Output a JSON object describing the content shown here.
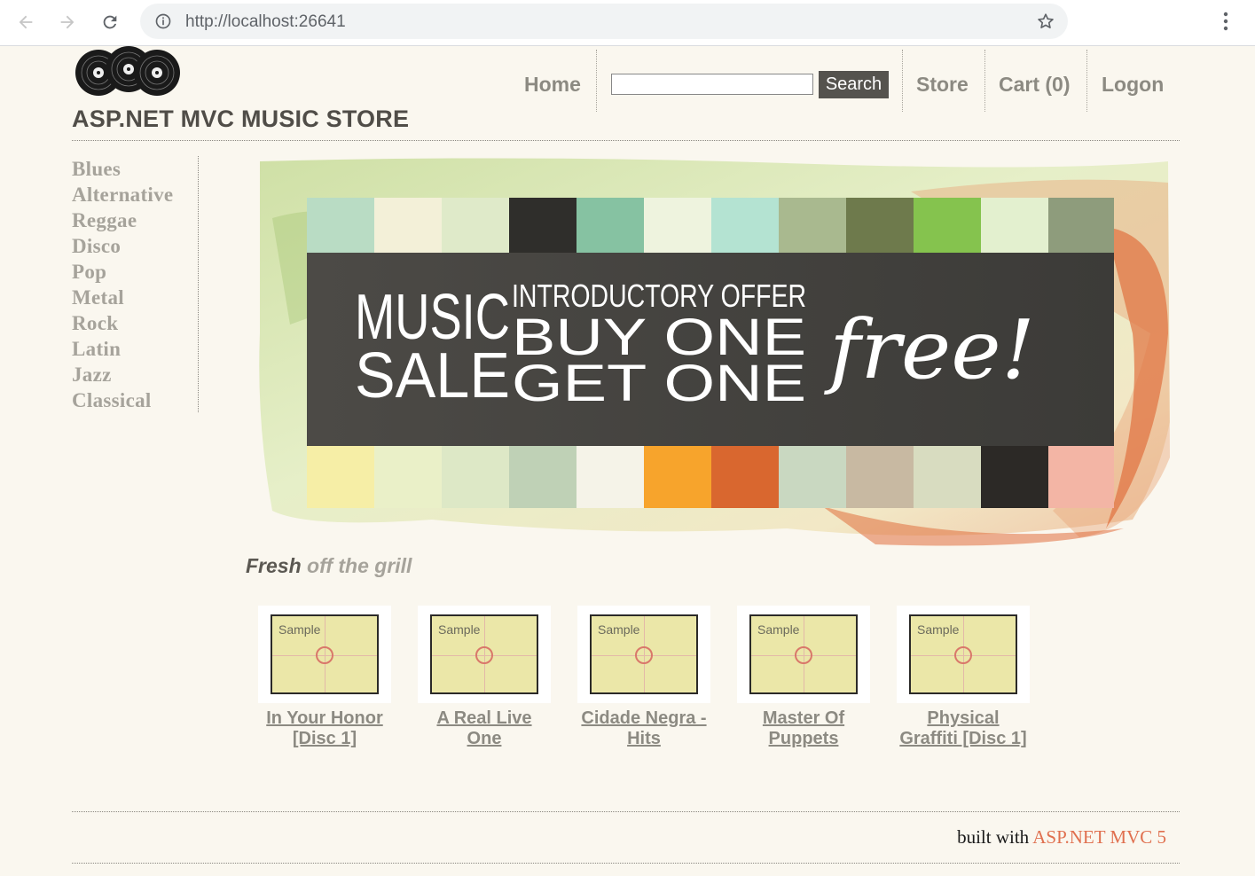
{
  "browser": {
    "url_host": "http://localhost",
    "url_port": ":26641"
  },
  "site": {
    "title": "ASP.NET MVC MUSIC STORE"
  },
  "nav": {
    "home": "Home",
    "search_button": "Search",
    "search_value": "",
    "store": "Store",
    "cart": "Cart (0)",
    "logon": "Logon"
  },
  "genres": [
    "Blues",
    "Alternative",
    "Reggae",
    "Disco",
    "Pop",
    "Metal",
    "Rock",
    "Latin",
    "Jazz",
    "Classical"
  ],
  "banner": {
    "line_music": "MUSIC",
    "line_sale": "SALE",
    "line_intro": "INTRODUCTORY OFFER",
    "line_buy": "BUY ONE",
    "line_get": "GET ONE",
    "line_free": "free!"
  },
  "fresh": {
    "strong": "Fresh",
    "rest": " off the grill"
  },
  "albums": [
    {
      "title": "In Your Honor [Disc 1]",
      "thumb_label": "Sample"
    },
    {
      "title": "A Real Live One",
      "thumb_label": "Sample"
    },
    {
      "title": "Cidade Negra - Hits",
      "thumb_label": "Sample"
    },
    {
      "title": "Master Of Puppets",
      "thumb_label": "Sample"
    },
    {
      "title": "Physical Graffiti [Disc 1]",
      "thumb_label": "Sample"
    }
  ],
  "footer": {
    "prefix": "built with ",
    "link": "ASP.NET MVC 5"
  },
  "colors": {
    "accent_orange": "#e0704f",
    "nav_gray": "#8c8a82",
    "background": "#faf7ef"
  }
}
